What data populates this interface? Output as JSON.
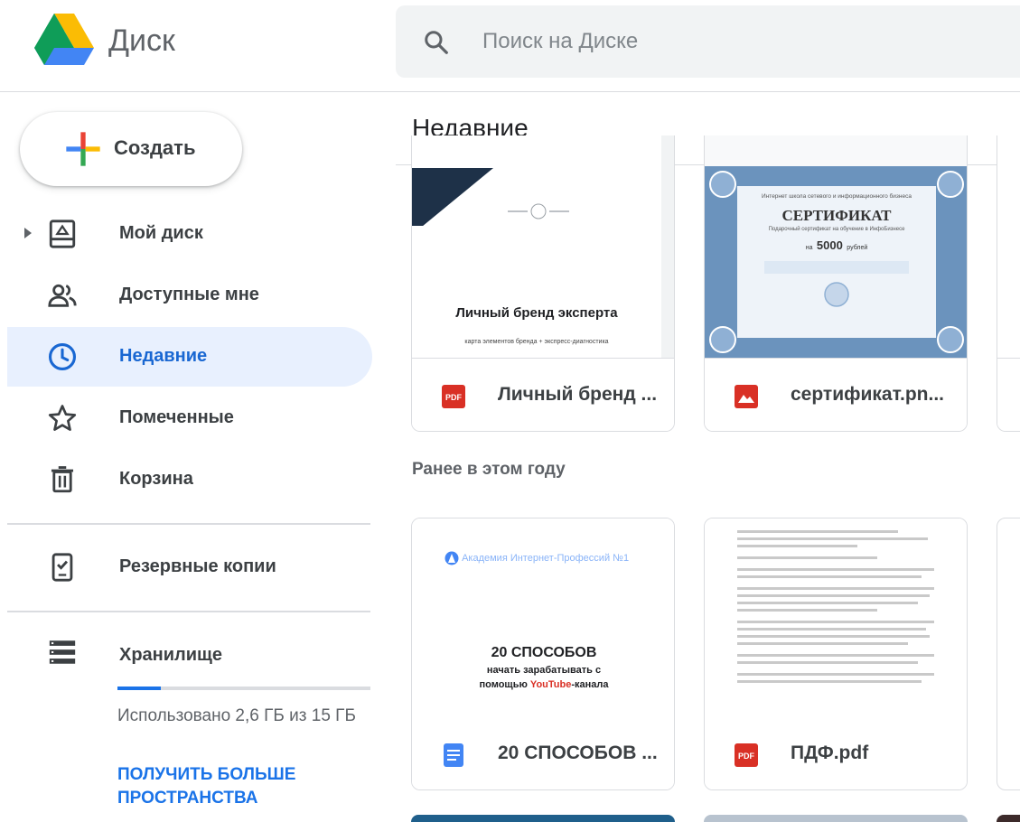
{
  "header": {
    "app_title": "Диск",
    "search_placeholder": "Поиск на Диске"
  },
  "sidebar": {
    "new_button": "Создать",
    "items": [
      {
        "label": "Мой диск",
        "icon": "drive-icon"
      },
      {
        "label": "Доступные мне",
        "icon": "people-icon"
      },
      {
        "label": "Недавние",
        "icon": "clock-icon",
        "active": true
      },
      {
        "label": "Помеченные",
        "icon": "star-icon"
      },
      {
        "label": "Корзина",
        "icon": "trash-icon"
      },
      {
        "label": "Резервные копии",
        "icon": "backup-icon"
      },
      {
        "label": "Хранилище",
        "icon": "storage-icon"
      }
    ],
    "storage": {
      "used_text": "Использовано 2,6 ГБ из 15 ГБ",
      "used_fraction": 0.17,
      "upgrade_link": "ПОЛУЧИТЬ БОЛЬШЕ ПРОСТРАНСТВА"
    }
  },
  "main": {
    "title": "Недавние",
    "section_earlier": "Ранее в этом году",
    "files": [
      {
        "name": "Личный бренд ...",
        "type": "pdf",
        "thumb_title": "Личный бренд эксперта",
        "thumb_subtitle": "карта элементов бренда + экспресс-диагностика"
      },
      {
        "name": "сертификат.pn...",
        "type": "image",
        "thumb_heading": "Интернет школа сетевого и информационного бизнеса",
        "thumb_title": "СЕРТИФИКАТ",
        "thumb_subtitle": "Подарочный сертификат на обучение в ИнфоБизнесе",
        "thumb_amount_prefix": "на",
        "thumb_amount": "5000",
        "thumb_amount_suffix": "рублей"
      },
      {
        "name": "20 СПОСОБОВ ...",
        "type": "doc",
        "thumb_brand": "Академия Интернет-Профессий №1",
        "thumb_title": "20 СПОСОБОВ",
        "thumb_line2": "начать зарабатывать с",
        "thumb_line3_pre": "помощью ",
        "thumb_line3_yt": "YouTube",
        "thumb_line3_post": "-канала"
      },
      {
        "name": "ПДФ.pdf",
        "type": "pdf"
      }
    ]
  },
  "colors": {
    "accent": "#1a73e8",
    "active_bg": "#e8f0fe",
    "pdf_red": "#d93025",
    "doc_blue": "#4285f4",
    "cert_blue": "#6b93bd"
  }
}
